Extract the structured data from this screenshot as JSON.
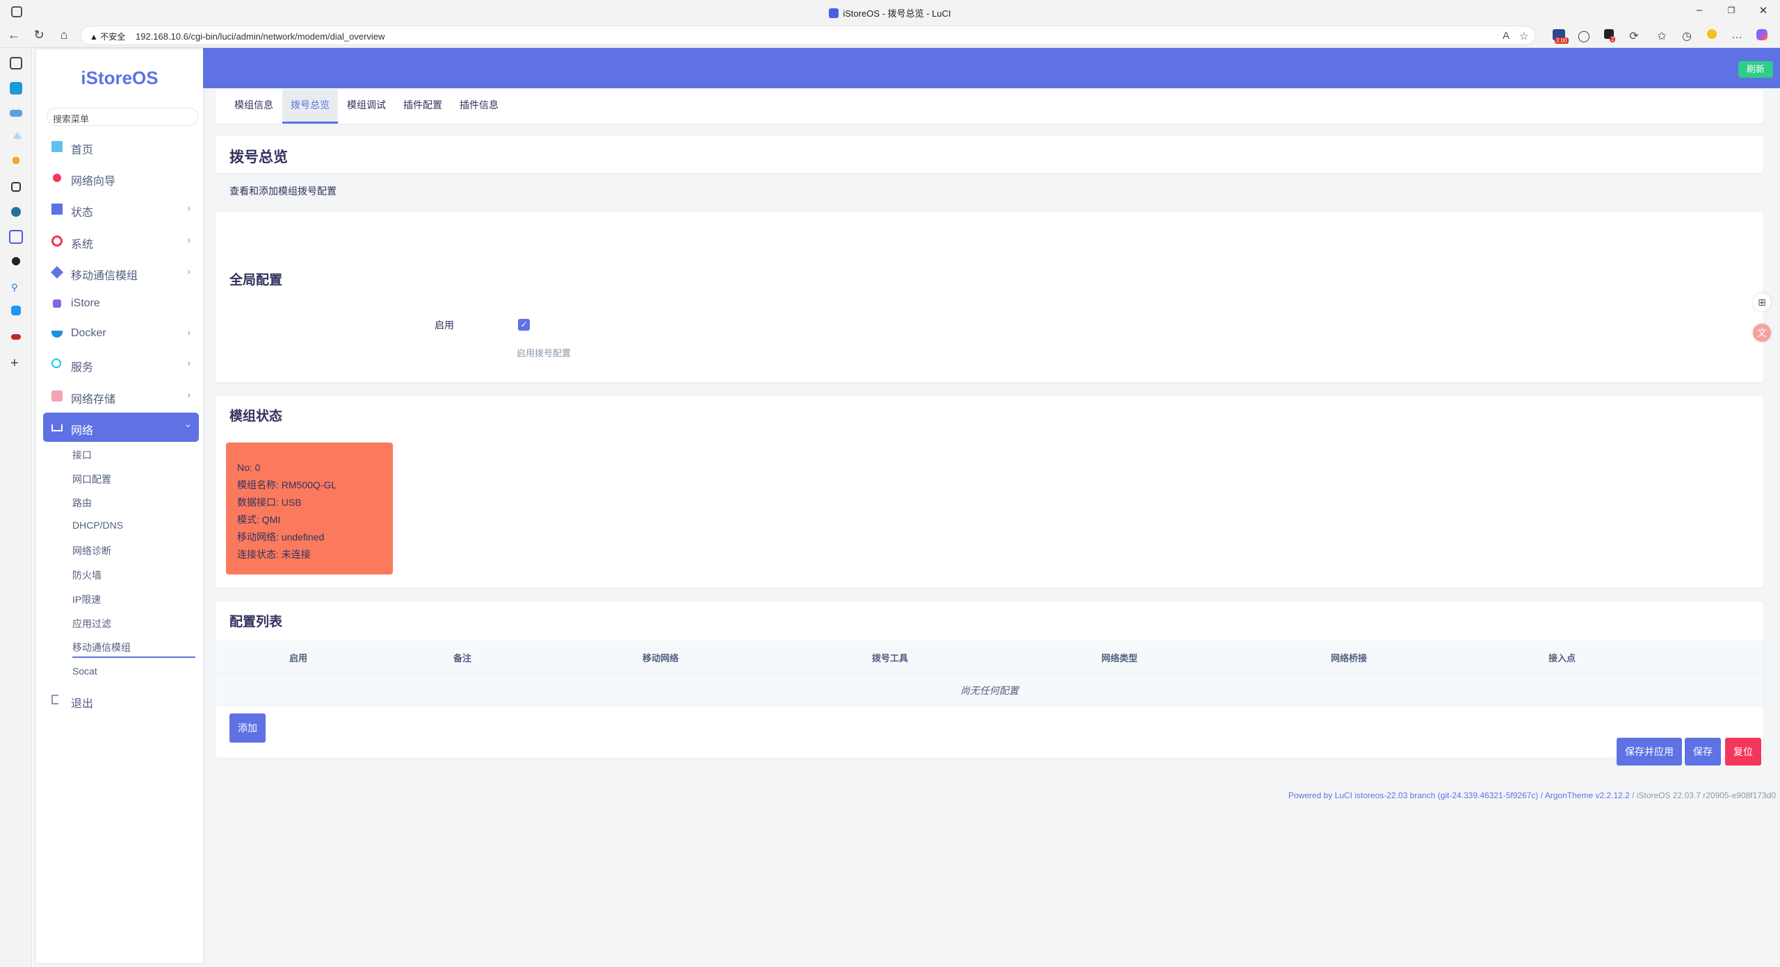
{
  "browser": {
    "window_title": "iStoreOS - 拨号总览 - LuCI",
    "security_label": "不安全",
    "url": "192.168.10.6/cgi-bin/luci/admin/network/modem/dial_overview",
    "ext_badge_1": "2.00",
    "ext_badge_2": "2"
  },
  "sidebar": {
    "logo": "iStoreOS",
    "search_placeholder": "搜索菜单",
    "items": [
      {
        "label": "首页",
        "icon": "home-icon"
      },
      {
        "label": "网络向导",
        "icon": "wizard-icon"
      },
      {
        "label": "状态",
        "icon": "status-icon"
      },
      {
        "label": "系统",
        "icon": "system-icon"
      },
      {
        "label": "移动通信模组",
        "icon": "modem-icon"
      },
      {
        "label": "iStore",
        "icon": "store-icon"
      },
      {
        "label": "Docker",
        "icon": "docker-icon"
      },
      {
        "label": "服务",
        "icon": "services-icon"
      },
      {
        "label": "网络存储",
        "icon": "storage-icon"
      },
      {
        "label": "网络",
        "icon": "network-icon"
      },
      {
        "label": "退出",
        "icon": "logout-icon"
      }
    ],
    "sub_items": [
      "接口",
      "网口配置",
      "路由",
      "DHCP/DNS",
      "网络诊断",
      "防火墙",
      "IP限速",
      "应用过滤",
      "移动通信模组",
      "Socat"
    ]
  },
  "header": {
    "refresh_label": "刷新"
  },
  "tabs": [
    "模组信息",
    "拨号总览",
    "模组调试",
    "插件配置",
    "插件信息"
  ],
  "overview": {
    "title": "拨号总览",
    "description": "查看和添加模组拨号配置"
  },
  "global": {
    "title": "全局配置",
    "enable_label": "启用",
    "enable_help": "启用拨号配置",
    "enabled": true
  },
  "modem_status": {
    "title": "模组状态",
    "lines": [
      "No: 0",
      "模组名称: RM500Q-GL",
      "数据接口: USB",
      "模式: QMI",
      "移动网络: undefined",
      "连接状态: 未连接"
    ]
  },
  "config_list": {
    "title": "配置列表",
    "columns": [
      "启用",
      "备注",
      "移动网络",
      "拨号工具",
      "网络类型",
      "网络桥接",
      "接入点"
    ],
    "empty_text": "尚无任何配置",
    "add_label": "添加"
  },
  "actions": {
    "save_apply": "保存并应用",
    "save": "保存",
    "reset": "复位"
  },
  "footer": {
    "text": "Powered by LuCI istoreos-22.03 branch (git-24.339.46321-5f9267c) / ArgonTheme v2.2.12.2",
    "version": "/ iStoreOS 22.03.7 r20905-e908f173d0"
  },
  "colors": {
    "primary": "#5e72e4",
    "success": "#2dce89",
    "danger": "#f5365c",
    "modem_card": "#fb7a5e"
  }
}
